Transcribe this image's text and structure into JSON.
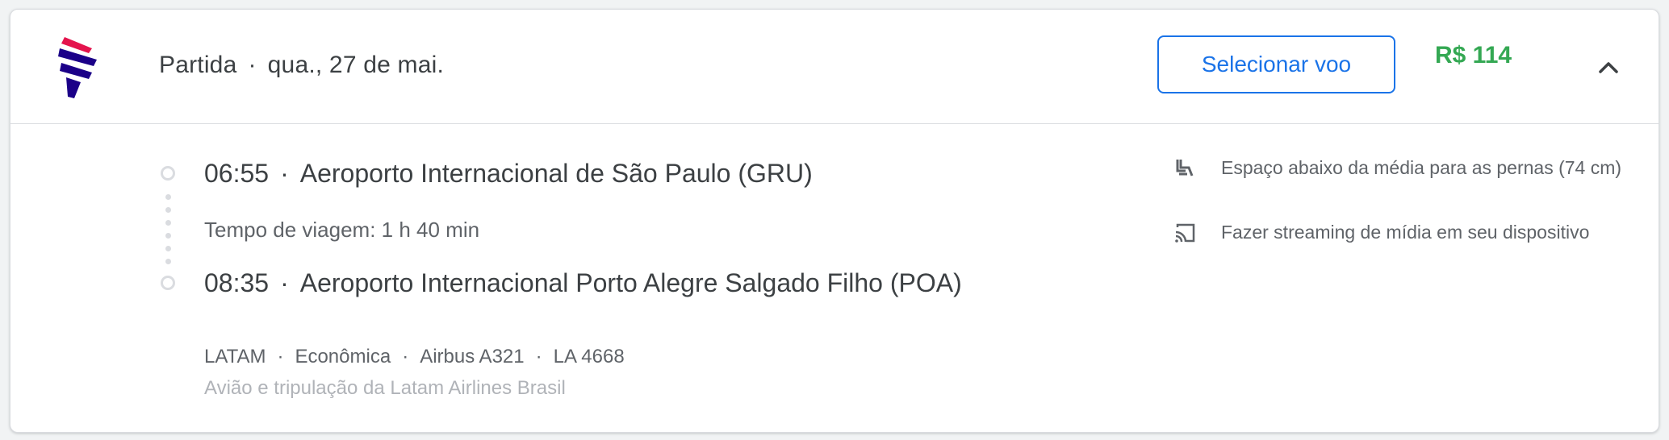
{
  "header": {
    "direction_label": "Partida",
    "separator": "·",
    "date_label": "qua., 27 de mai.",
    "select_button_label": "Selecionar voo",
    "price": "R$ 114",
    "logo_icon": "latam-logo-icon",
    "collapse_icon": "chevron-up-icon"
  },
  "itinerary": {
    "departure": {
      "time": "06:55",
      "airport": "Aeroporto Internacional de São Paulo (GRU)"
    },
    "travel_time": "Tempo de viagem: 1 h 40 min",
    "arrival": {
      "time": "08:35",
      "airport": "Aeroporto Internacional Porto Alegre Salgado Filho (POA)"
    }
  },
  "flight_details": {
    "airline": "LATAM",
    "cabin": "Econômica",
    "aircraft": "Airbus A321",
    "flight_number": "LA 4668",
    "operator": "Avião e tripulação da Latam Airlines Brasil"
  },
  "amenities": [
    {
      "icon": "legroom-seat-icon",
      "text": "Espaço abaixo da média para as pernas (74 cm)"
    },
    {
      "icon": "cast-streaming-icon",
      "text": "Fazer streaming de mídia em seu dispositivo"
    }
  ],
  "colors": {
    "accent_blue": "#1a73e8",
    "price_green": "#34a853",
    "text_primary": "#3c4043",
    "text_secondary": "#5f6368",
    "border": "#dadce0"
  }
}
